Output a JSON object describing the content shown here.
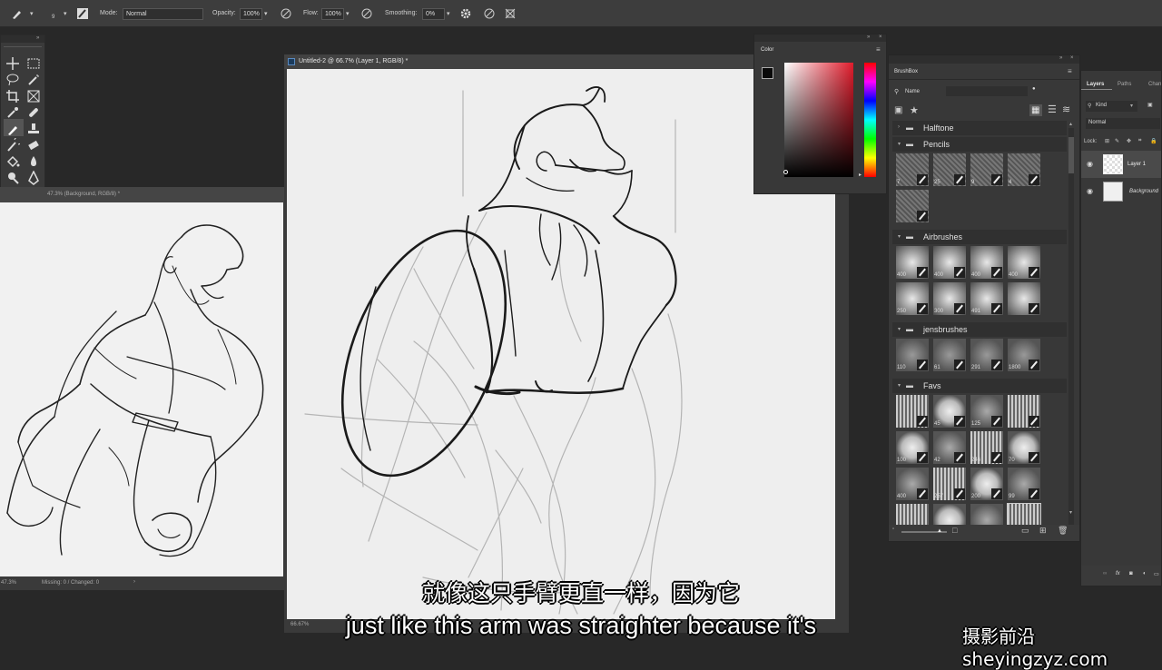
{
  "options_bar": {
    "brush_size": "9",
    "mode_label": "Mode:",
    "mode_value": "Normal",
    "opacity_label": "Opacity:",
    "opacity_value": "100%",
    "flow_label": "Flow:",
    "flow_value": "100%",
    "smoothing_label": "Smoothing:",
    "smoothing_value": "0%"
  },
  "doc_left": {
    "title": "47.3% (Background, RGB/8) *",
    "zoom": "47.3%",
    "status": "Missing: 0 / Changed: 0"
  },
  "doc_main": {
    "title": "Untitled-2 @ 66.7% (Layer 1, RGB/8) *",
    "zoom": "66.67%"
  },
  "color_panel": {
    "title": "Color"
  },
  "brushbox": {
    "title": "BrushBox",
    "search_label": "Name",
    "groups": [
      {
        "name": "Halftone"
      },
      {
        "name": "Pencils",
        "sizes": [
          "7",
          "25",
          "9",
          "4",
          ""
        ]
      },
      {
        "name": "Airbrushes",
        "sizes": [
          "400",
          "400",
          "400",
          "400",
          "250",
          "300",
          "491",
          ""
        ]
      },
      {
        "name": "jensbrushes",
        "sizes": [
          "110",
          "61",
          "291",
          "1800"
        ]
      },
      {
        "name": "Favs",
        "sizes": [
          "",
          "45",
          "125",
          "",
          "100",
          "42",
          "246",
          "70",
          "400",
          "257",
          "200",
          "99",
          "150",
          "50",
          "9",
          "20"
        ]
      }
    ]
  },
  "layers": {
    "tabs": [
      "Layers",
      "Paths",
      "Chan"
    ],
    "kind_label": "Kind",
    "blend_mode": "Normal",
    "lock_label": "Lock:",
    "items": [
      {
        "name": "Layer 1"
      },
      {
        "name": "Background"
      }
    ]
  },
  "subtitles": {
    "chinese": "就像这只手臂更直一样，因为它",
    "english": "just like this arm was straighter because it's"
  },
  "watermark": "摄影前沿 sheyingzyz.com",
  "colors": {
    "ui_dark": "#282828",
    "panel": "#383838",
    "canvas": "#eeeeee",
    "accent_blue": "#6aa0e0"
  }
}
